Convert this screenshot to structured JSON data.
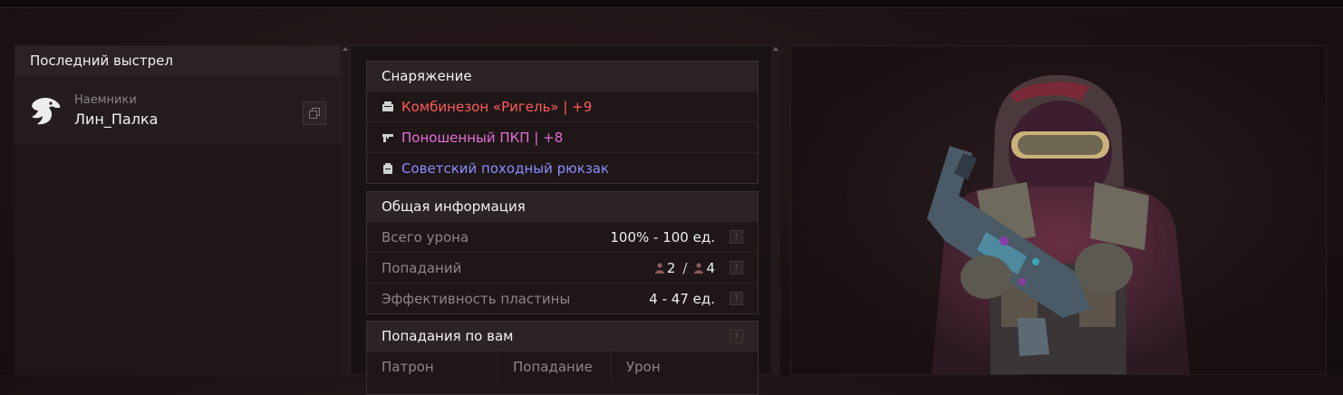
{
  "left": {
    "header": "Последний выстрел",
    "killer": {
      "faction": "Наемники",
      "name": "Лин_Палка"
    }
  },
  "equipment": {
    "title": "Снаряжение",
    "items": [
      {
        "label": "Комбинезон «Ригель» | +9",
        "color": "#ff5b5b",
        "icon": "armor-icon"
      },
      {
        "label": "Поношенный ПКП | +8",
        "color": "#e36fd6",
        "icon": "gun-icon"
      },
      {
        "label": "Советский походный рюкзак",
        "color": "#8c8cff",
        "icon": "backpack-icon"
      }
    ]
  },
  "general": {
    "title": "Общая информация",
    "rows": [
      {
        "label": "Всего урона",
        "value": "100% - 100 ед."
      },
      {
        "label": "Попаданий",
        "hit_a": "2",
        "hit_b": "4"
      },
      {
        "label": "Эффективность пластины",
        "value": "4 - 47 ед."
      }
    ]
  },
  "hits": {
    "title": "Попадания по вам",
    "columns": [
      "Патрон",
      "Попадание",
      "Урон"
    ]
  },
  "help_glyph": "?"
}
